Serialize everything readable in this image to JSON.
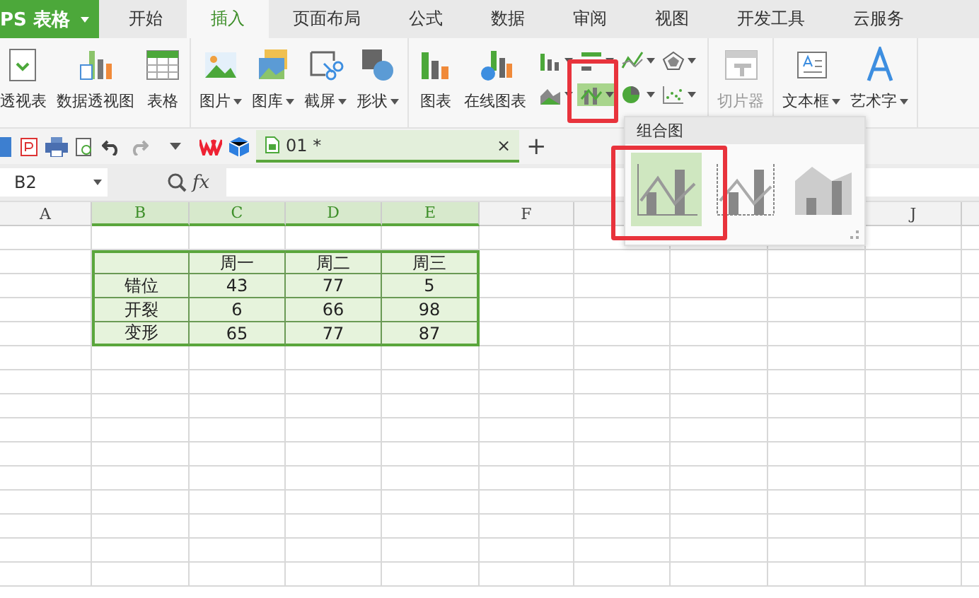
{
  "app_button": {
    "label": "PS 表格"
  },
  "tabs": [
    {
      "label": "开始",
      "selected": false
    },
    {
      "label": "插入",
      "selected": true
    },
    {
      "label": "页面布局",
      "selected": false
    },
    {
      "label": "公式",
      "selected": false
    },
    {
      "label": "数据",
      "selected": false
    },
    {
      "label": "审阅",
      "selected": false
    },
    {
      "label": "视图",
      "selected": false
    },
    {
      "label": "开发工具",
      "selected": false
    },
    {
      "label": "云服务",
      "selected": false
    }
  ],
  "ribbon_groups": [
    {
      "items": [
        {
          "kind": "pivot-table",
          "label": "透视表",
          "dropdown": false,
          "disabled": false
        },
        {
          "kind": "pivot-chart",
          "label": "数据透视图",
          "dropdown": false,
          "disabled": false
        },
        {
          "kind": "table",
          "label": "表格",
          "dropdown": false,
          "disabled": false
        }
      ]
    },
    {
      "items": [
        {
          "kind": "picture",
          "label": "图片",
          "dropdown": true,
          "disabled": false
        },
        {
          "kind": "gallery",
          "label": "图库",
          "dropdown": true,
          "disabled": false
        },
        {
          "kind": "screenshot",
          "label": "截屏",
          "dropdown": true,
          "disabled": false
        },
        {
          "kind": "shape",
          "label": "形状",
          "dropdown": true,
          "disabled": false
        }
      ]
    },
    {
      "items": [
        {
          "kind": "chart",
          "label": "图表",
          "dropdown": false,
          "disabled": false
        },
        {
          "kind": "online-chart",
          "label": "在线图表",
          "dropdown": false,
          "disabled": false
        }
      ],
      "chart_buttons": [
        {
          "kind": "column",
          "selected": false
        },
        {
          "kind": "bar",
          "selected": false
        },
        {
          "kind": "line",
          "selected": false
        },
        {
          "kind": "radar",
          "selected": false
        },
        {
          "kind": "area",
          "selected": false
        },
        {
          "kind": "combo",
          "selected": true
        },
        {
          "kind": "pie",
          "selected": false
        },
        {
          "kind": "scatter",
          "selected": false
        }
      ]
    },
    {
      "items": [
        {
          "kind": "slicer",
          "label": "切片器",
          "dropdown": false,
          "disabled": true
        }
      ]
    },
    {
      "items": [
        {
          "kind": "textbox",
          "label": "文本框",
          "dropdown": true,
          "disabled": false
        },
        {
          "kind": "wordart",
          "label": "艺术字",
          "dropdown": true,
          "disabled": false
        }
      ]
    }
  ],
  "doc_tab": {
    "label": "01 *",
    "close": "×",
    "new_tab": "+"
  },
  "formula_bar": {
    "name_box": "B2",
    "fx": "fx"
  },
  "columns": [
    {
      "label": "A",
      "selected": false
    },
    {
      "label": "B",
      "selected": true
    },
    {
      "label": "C",
      "selected": true
    },
    {
      "label": "D",
      "selected": true
    },
    {
      "label": "E",
      "selected": true
    },
    {
      "label": "F",
      "selected": false
    }
  ],
  "columns_right": [
    {
      "label": "J",
      "selected": false
    }
  ],
  "table": {
    "columns": [
      "周一",
      "周二",
      "周三"
    ],
    "rows": [
      {
        "label": "错位",
        "values": [
          "43",
          "77",
          "5"
        ]
      },
      {
        "label": "开裂",
        "values": [
          "6",
          "66",
          "98"
        ]
      },
      {
        "label": "变形",
        "values": [
          "65",
          "77",
          "87"
        ]
      }
    ]
  },
  "popup": {
    "title": "组合图",
    "options": [
      {
        "kind": "column-line",
        "selected": true
      },
      {
        "kind": "column-line-axis",
        "selected": false
      },
      {
        "kind": "area-column",
        "selected": false
      }
    ]
  }
}
